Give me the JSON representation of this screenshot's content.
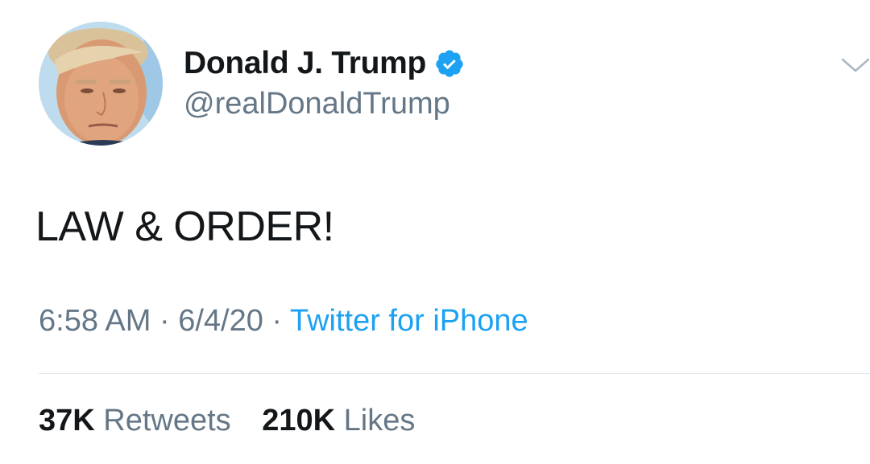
{
  "author": {
    "display_name": "Donald J. Trump",
    "handle": "@realDonaldTrump",
    "verified": true,
    "avatar_icon": "profile-photo"
  },
  "tweet": {
    "text": "LAW & ORDER!"
  },
  "meta": {
    "time": "6:58 AM",
    "separator": "·",
    "date": "6/4/20",
    "source": "Twitter for iPhone"
  },
  "stats": {
    "retweets_count": "37K",
    "retweets_label": "Retweets",
    "likes_count": "210K",
    "likes_label": "Likes"
  },
  "colors": {
    "text_primary": "#14171a",
    "text_secondary": "#657786",
    "link": "#1da1f2",
    "verified_badge": "#1da1f2",
    "divider": "#e1e8ed"
  },
  "icons": {
    "verified": "verified-badge-icon",
    "menu": "chevron-down-icon"
  }
}
